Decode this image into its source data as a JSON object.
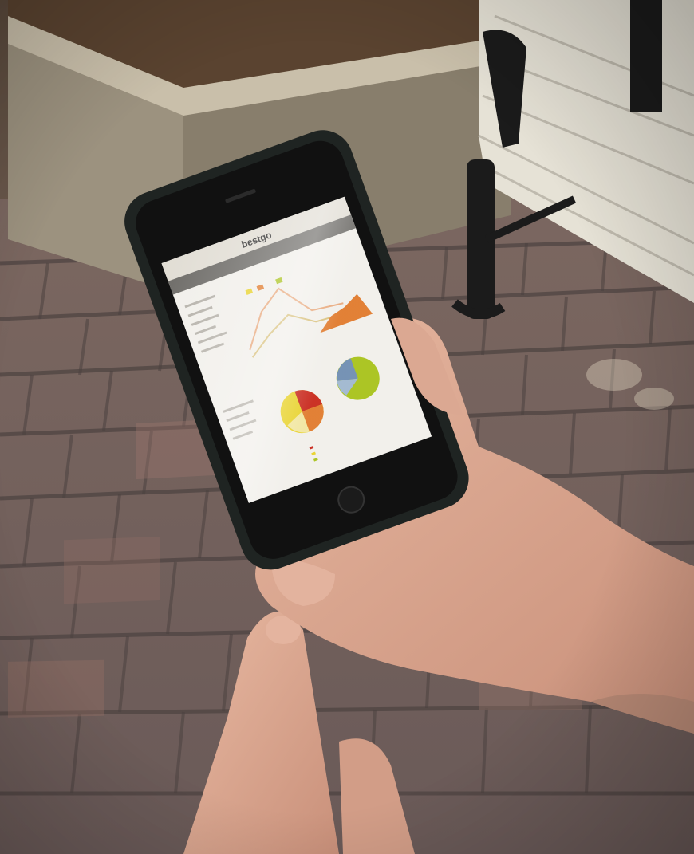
{
  "scene": {
    "description_free": true,
    "background_elements": [
      "brick-pavement",
      "stone-planter",
      "park-bench"
    ],
    "hands": [
      "left-hand-holding-phone",
      "right-index-finger-pointing"
    ]
  },
  "phone": {
    "screen": {
      "app_logo_text": "bestgo",
      "charts_visible": [
        "line-chart",
        "bar-chart",
        "pie-chart-red-yellow",
        "pie-chart-green"
      ]
    }
  },
  "colors": {
    "brick": "#8a6f66",
    "brick_mortar": "#4e4543",
    "planter_stone": "#b5ab98",
    "mulch": "#5a4330",
    "bench_slat": "#e9e6dc",
    "bench_frame": "#1b1b1b",
    "phone_case": "#1f2422",
    "screen_bg": "#f1efea",
    "skin": "#d9a58d",
    "pie_red": "#c8271b",
    "pie_yellow": "#e8d22a",
    "pie_green": "#a8c21a",
    "chart_orange": "#e07a2c"
  }
}
